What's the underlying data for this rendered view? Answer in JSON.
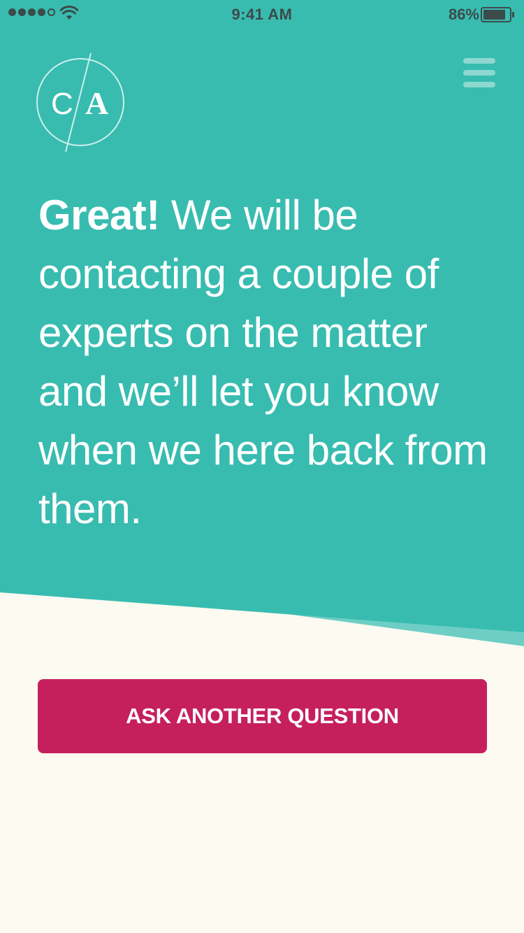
{
  "status_bar": {
    "time": "9:41 AM",
    "battery_percent": "86%",
    "signal_bars_filled": 4,
    "signal_bars_total": 5,
    "battery_level": 0.86,
    "icons": [
      "signal-dots-icon",
      "wifi-icon",
      "battery-icon"
    ]
  },
  "header": {
    "logo_text_left": "C",
    "logo_text_right": "A",
    "menu_icon": "hamburger-menu-icon"
  },
  "message": {
    "emphasis": "Great!",
    "body": " We will be contacting a couple of experts on the matter and we’ll let you know when we here back from them."
  },
  "actions": {
    "ask_another_label": "ASK ANOTHER QUESTION"
  },
  "colors": {
    "teal": "#38BCB0",
    "teal_light": "#6ECEC5",
    "cream": "#FDFAF2",
    "primary_button": "#C5205C",
    "status_text": "#3D4A4A"
  }
}
